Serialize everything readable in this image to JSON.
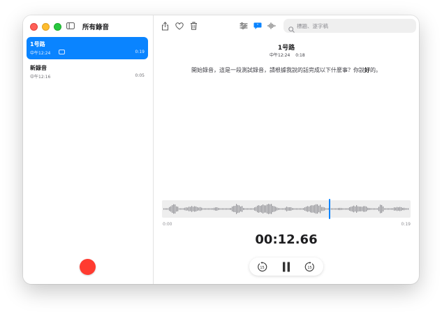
{
  "sidebar": {
    "title": "所有錄音",
    "recordings": [
      {
        "name": "1号路",
        "time": "中午12:24",
        "duration": "0:19",
        "has_transcript": true,
        "selected": true
      },
      {
        "name": "新錄音",
        "time": "中午12:16",
        "duration": "0:05",
        "has_transcript": false,
        "selected": false
      }
    ]
  },
  "toolbar": {
    "icons": [
      "share-icon",
      "heart-icon",
      "trash-icon",
      "sliders-icon",
      "transcript-icon",
      "waveform-icon"
    ],
    "search_placeholder": "標題、逐字稿"
  },
  "detail": {
    "title": "1号路",
    "time": "中午12:24",
    "duration": "0:18",
    "transcript_prefix": "開始錄音，這是一段測試錄音，請根據我說的話完成以下什麼事？你說",
    "transcript_highlight": "好",
    "transcript_suffix": "的。",
    "timeline_start": "0:00",
    "timeline_end": "0:19",
    "playhead_fraction": 0.67,
    "current_time": "00:12.66",
    "skip_back_label": "15",
    "skip_forward_label": "15"
  },
  "colors": {
    "accent": "#0a84ff",
    "record": "#ff3b30",
    "waveform": "#8e8e93"
  }
}
